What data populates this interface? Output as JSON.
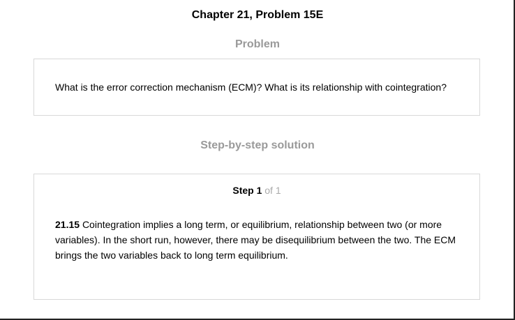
{
  "header": {
    "title": "Chapter 21, Problem 15E"
  },
  "problem": {
    "heading": "Problem",
    "text": "What is the error correction mechanism (ECM)? What is its relationship with cointegration?"
  },
  "solution": {
    "heading": "Step-by-step solution",
    "step_label": "Step 1",
    "step_of": "of 1",
    "answer_number": "21.15",
    "answer_text": "Cointegration implies a long term, or equilibrium, relationship between two (or more variables). In the short run, however, there may be disequilibrium between the two. The ECM brings the two variables back to long term equilibrium."
  }
}
